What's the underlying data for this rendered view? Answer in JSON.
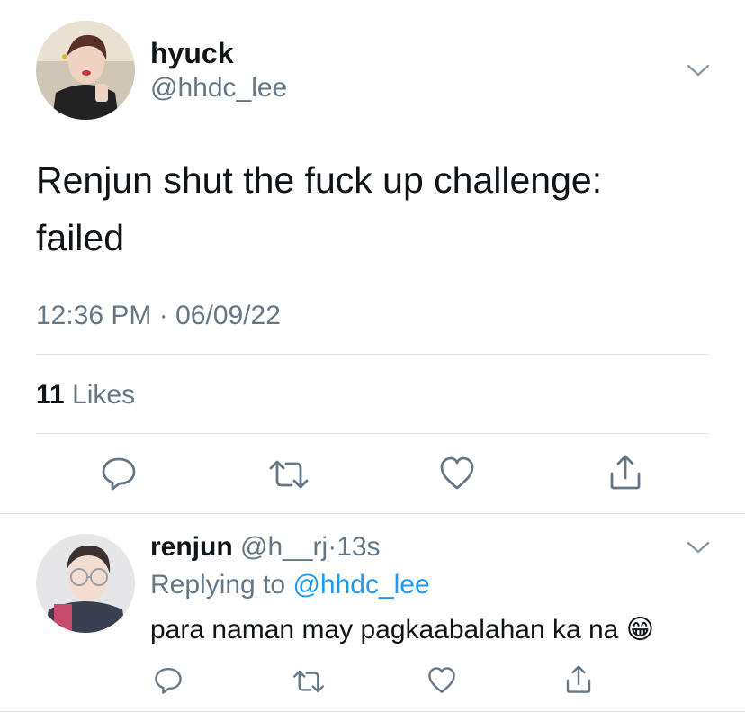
{
  "main_tweet": {
    "display_name": "hyuck",
    "handle": "@hhdc_lee",
    "text_line1": "Renjun shut the fuck up challenge:",
    "text_line2": "failed",
    "time": "12:36 PM",
    "separator": "·",
    "date": "06/09/22",
    "likes_count": "11",
    "likes_label": "Likes"
  },
  "reply": {
    "display_name": "renjun",
    "handle": "@h__rj",
    "separator": "·",
    "age": "13s",
    "replying_label": "Replying to",
    "replying_handle": "@hhdc_lee",
    "text": "para naman may pagkaabalahan ka na",
    "emoji": "😁"
  },
  "icons": {
    "caret": "chevron-down-icon",
    "reply": "comment-icon",
    "retweet": "retweet-icon",
    "like": "heart-icon",
    "share": "share-icon"
  },
  "colors": {
    "text": "#0f1419",
    "muted": "#657786",
    "link": "#1d9bf0",
    "divider": "#dfe4e8"
  }
}
